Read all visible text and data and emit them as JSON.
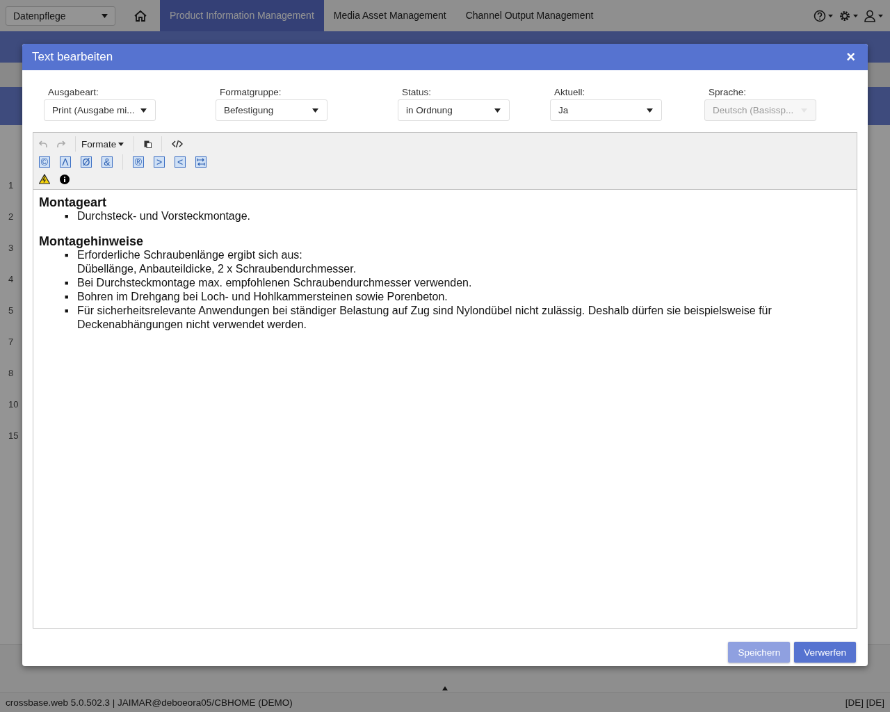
{
  "app_bar": {
    "workspace": "Datenpflege",
    "tabs": [
      {
        "label": "Product Information Management",
        "selected": true
      },
      {
        "label": "Media Asset Management",
        "selected": false
      },
      {
        "label": "Channel Output Management",
        "selected": false
      }
    ]
  },
  "list": {
    "row_numbers": [
      "1",
      "2",
      "3",
      "4",
      "5",
      "7",
      "8",
      "10",
      "15"
    ]
  },
  "status_bar": {
    "version": "crossbase.web 5.0.502.3 | JAIMAR@deboeora05/CBHOME (DEMO)",
    "languages": "[DE] [DE]"
  },
  "dialog": {
    "title": "Text bearbeiten",
    "close": "×",
    "fields": [
      {
        "label": "Ausgabeart:",
        "value": "Print (Ausgabe mi...",
        "disabled": false
      },
      {
        "label": "Formatgruppe:",
        "value": "Befestigung",
        "disabled": false
      },
      {
        "label": "Status:",
        "value": "in Ordnung",
        "disabled": false
      },
      {
        "label": "Aktuell:",
        "value": "Ja",
        "disabled": false
      },
      {
        "label": "Sprache:",
        "value": "Deutsch (Basissp...",
        "disabled": true
      }
    ],
    "toolbar": {
      "formats": "Formate",
      "undo_disabled": true,
      "redo_disabled": true,
      "symbols": [
        {
          "kind": "char",
          "text": "©"
        },
        {
          "kind": "char",
          "text": "Λ"
        },
        {
          "kind": "char",
          "text": "Ø"
        },
        {
          "kind": "char",
          "text": "&"
        },
        {
          "kind": "sep"
        },
        {
          "kind": "char",
          "text": "®"
        },
        {
          "kind": "char",
          "text": ">"
        },
        {
          "kind": "char",
          "text": "<"
        },
        {
          "kind": "tab"
        }
      ]
    },
    "content": [
      {
        "heading": "Montageart",
        "bullet": "■",
        "items": [
          {
            "lines": [
              "Durchsteck- und Vorsteckmontage."
            ]
          }
        ]
      },
      {
        "heading": "Montagehinweise",
        "bullet": "■",
        "items": [
          {
            "lines": [
              "Erforderliche Schraubenlänge ergibt sich aus:",
              "Dübellänge, Anbauteildicke, 2 x Schraubendurchmesser."
            ]
          },
          {
            "lines": [
              "Bei Durchsteckmontage max. empfohlenen Schraubendurchmesser verwenden."
            ]
          },
          {
            "lines": [
              "Bohren im Drehgang bei Loch- und Hohlkammersteinen sowie Porenbeton."
            ]
          },
          {
            "lines": [
              "Für sicherheitsrelevante Anwendungen bei ständiger Belastung auf Zug sind Nylondübel nicht zulässig. Deshalb dürfen sie beispielsweise für Deckenabhängungen nicht verwendet werden."
            ]
          }
        ]
      }
    ],
    "buttons": [
      {
        "label": "Speichern",
        "disabled": true
      },
      {
        "label": "Verwerfen",
        "disabled": false
      }
    ]
  }
}
